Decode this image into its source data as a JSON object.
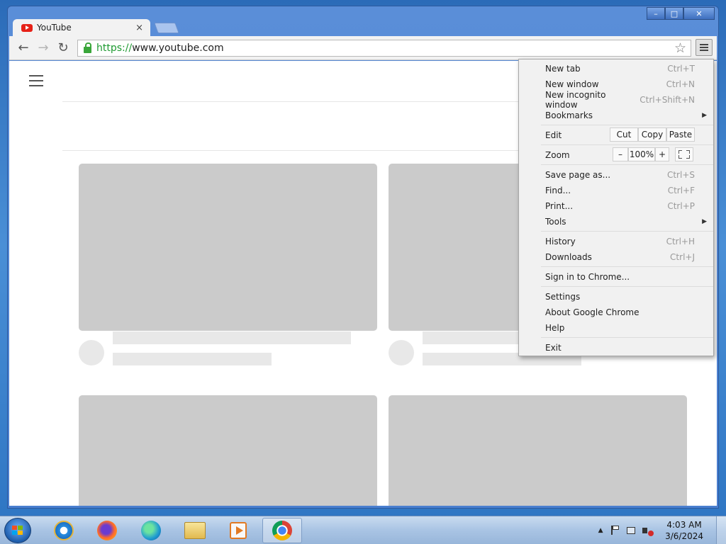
{
  "window": {
    "controls": {
      "minimize": "–",
      "maximize": "□",
      "close": "✕"
    }
  },
  "tab": {
    "title": "YouTube",
    "close": "×"
  },
  "toolbar": {
    "back": "←",
    "forward": "→",
    "reload": "↻",
    "url_scheme": "https://",
    "url_rest": "www.youtube.com",
    "star": "☆"
  },
  "menu": {
    "items": [
      {
        "label": "New tab",
        "shortcut": "Ctrl+T"
      },
      {
        "label": "New window",
        "shortcut": "Ctrl+N"
      },
      {
        "label": "New incognito window",
        "shortcut": "Ctrl+Shift+N"
      },
      {
        "label": "Bookmarks",
        "shortcut": ""
      },
      {
        "label": "Edit",
        "shortcut": ""
      },
      {
        "label": "Zoom",
        "shortcut": ""
      },
      {
        "label": "Save page as...",
        "shortcut": "Ctrl+S"
      },
      {
        "label": "Find...",
        "shortcut": "Ctrl+F"
      },
      {
        "label": "Print...",
        "shortcut": "Ctrl+P"
      },
      {
        "label": "Tools",
        "shortcut": ""
      },
      {
        "label": "History",
        "shortcut": "Ctrl+H"
      },
      {
        "label": "Downloads",
        "shortcut": "Ctrl+J"
      },
      {
        "label": "Sign in to Chrome...",
        "shortcut": ""
      },
      {
        "label": "Settings",
        "shortcut": ""
      },
      {
        "label": "About Google Chrome",
        "shortcut": ""
      },
      {
        "label": "Help",
        "shortcut": ""
      },
      {
        "label": "Exit",
        "shortcut": ""
      }
    ],
    "edit": {
      "cut": "Cut",
      "copy": "Copy",
      "paste": "Paste"
    },
    "zoom": {
      "minus": "–",
      "value": "100%",
      "plus": "+"
    },
    "submenu_arrow": "▶"
  },
  "taskbar": {
    "clock_time": "4:03 AM",
    "clock_date": "3/6/2024",
    "tray_arrow": "▲"
  }
}
